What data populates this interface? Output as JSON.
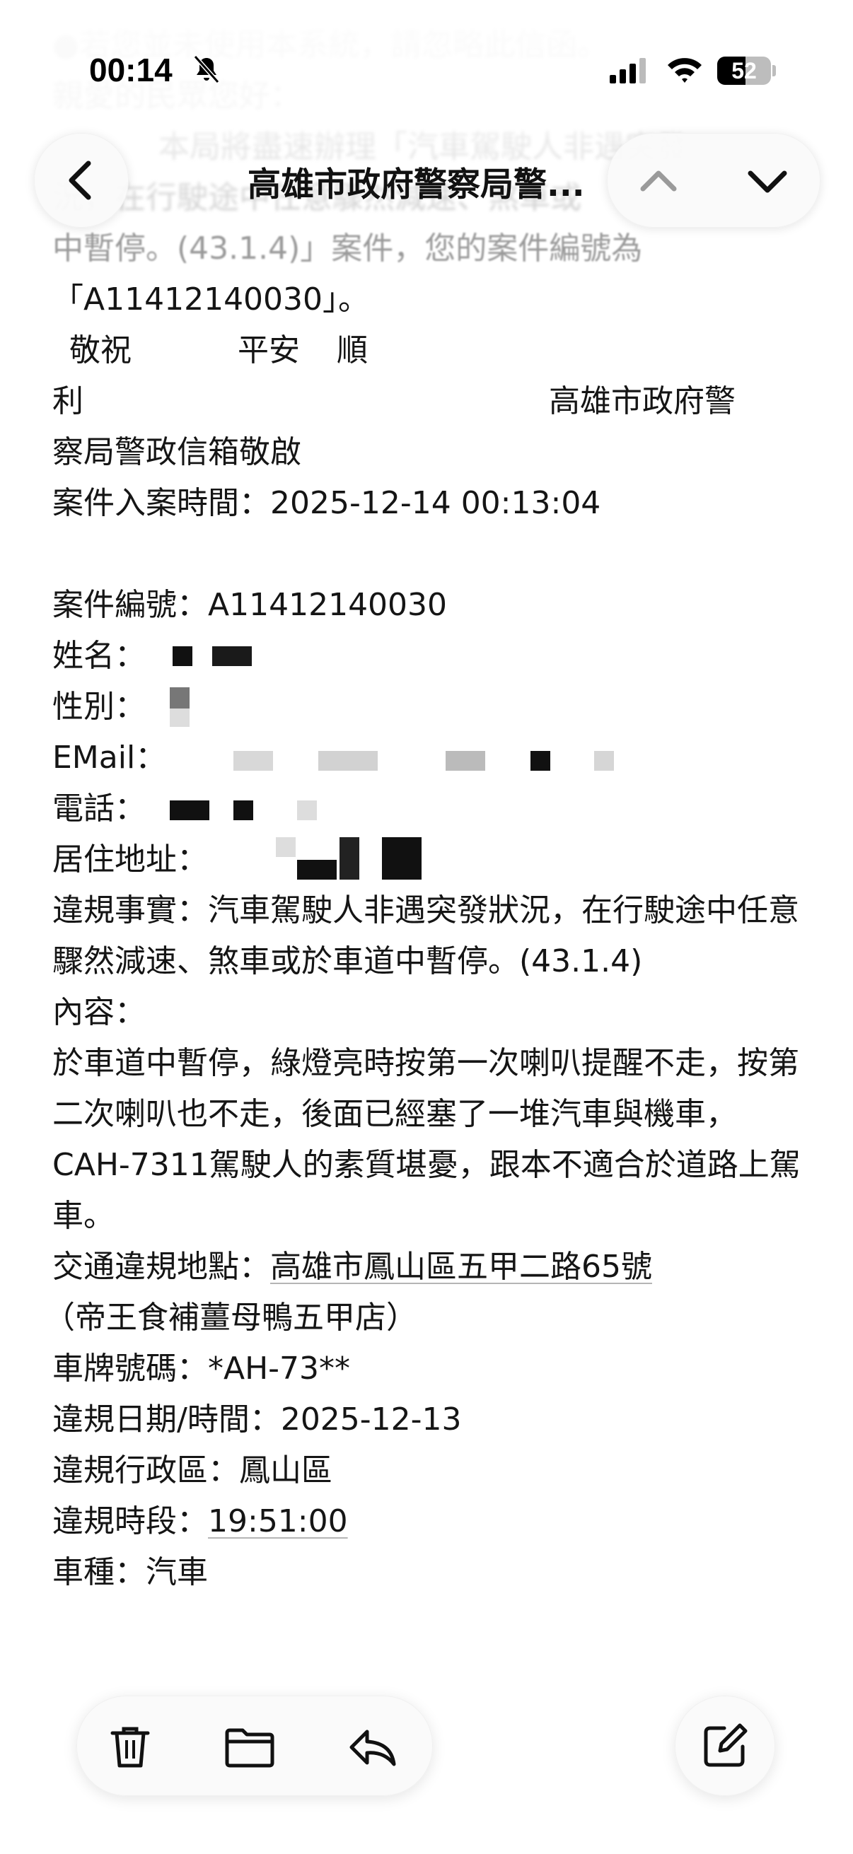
{
  "status_bar": {
    "time": "00:14",
    "battery": "52"
  },
  "nav": {
    "title": "高雄市政府警察局警..."
  },
  "email": {
    "faded_lines": [
      "●若您並未使用本系統，請忽略此信函。",
      "親愛的民眾您好：",
      "本局將盡速辦理「汽車駕駛人非遇突發",
      "況，在行駛途中任意驟然減速、煞車或",
      "中暫停。(43.1.4)」案件，您的案件編號為"
    ],
    "case_no_quote": "「A11412140030」。",
    "greeting_a": "敬祝",
    "greeting_b": "平安",
    "greeting_c": "順",
    "greeting_d": "利",
    "signature_a": "高雄市政府警",
    "signature_b": "察局警政信箱敬啟",
    "filed_time": "案件入案時間：2025-12-14 00:13:04",
    "case_no": "案件編號：A11412140030",
    "name_label": "姓名：",
    "gender_label": "性別：",
    "email_label": "EMail：",
    "phone_label": "電話：",
    "address_label": "居住地址：",
    "violation_fact": "違規事實：汽車駕駛人非遇突發狀況，在行駛途中任意驟然減速、煞車或於車道中暫停。(43.1.4)",
    "content_label": "內容：",
    "content_body": "於車道中暫停，綠燈亮時按第一次喇叭提醒不走，按第二次喇叭也不走，後面已經塞了一堆汽車與機車，CAH-7311駕駛人的素質堪憂，跟本不適合於道路上駕車。",
    "location_label": "交通違規地點：",
    "location_value": "高雄市鳳山區五甲二路65號",
    "location_note": "（帝王食補薑母鴨五甲店）",
    "plate": "車牌號碼：*AH-73**",
    "date_time": "違規日期/時間：2025-12-13",
    "district": "違規行政區：鳳山區",
    "period_label": "違規時段：",
    "period_value": "19:51:00",
    "vehicle_type": "車種：汽車"
  },
  "icons": {
    "back": "chevron-left-icon",
    "prev": "chevron-up-icon",
    "next": "chevron-down-icon",
    "trash": "trash-icon",
    "folder": "folder-icon",
    "reply": "reply-icon",
    "compose": "compose-icon"
  }
}
